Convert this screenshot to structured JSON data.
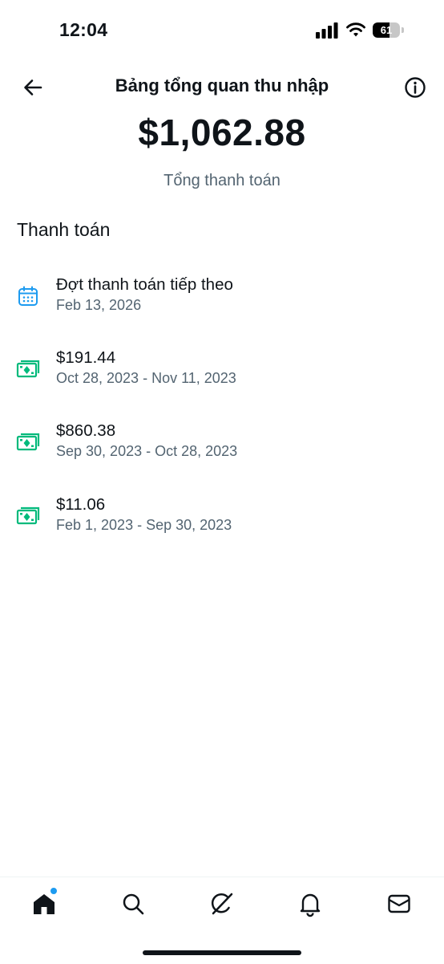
{
  "status_bar": {
    "time": "12:04",
    "battery": "61",
    "battery_level": 0.61
  },
  "header": {
    "title": "Bảng tổng quan thu nhập"
  },
  "summary": {
    "amount": "$1,062.88",
    "label": "Tổng thanh toán"
  },
  "payments": {
    "section_title": "Thanh toán",
    "items": [
      {
        "title": "Đợt thanh toán tiếp theo",
        "subtitle": "Feb 13, 2026",
        "icon": "calendar-icon"
      },
      {
        "title": "$191.44",
        "subtitle": "Oct 28, 2023 - Nov 11, 2023",
        "icon": "money-icon"
      },
      {
        "title": "$860.38",
        "subtitle": "Sep 30, 2023 - Oct 28, 2023",
        "icon": "money-icon"
      },
      {
        "title": "$11.06",
        "subtitle": "Feb 1, 2023 - Sep 30, 2023",
        "icon": "money-icon"
      }
    ]
  },
  "tab_bar": {
    "tabs": [
      "home-icon",
      "search-icon",
      "grok-icon",
      "notifications-icon",
      "messages-icon"
    ]
  },
  "colors": {
    "accent": "#1d9bf0",
    "money": "#00ba7c",
    "calendar": "#1d9bf0",
    "muted_text": "#536471"
  }
}
